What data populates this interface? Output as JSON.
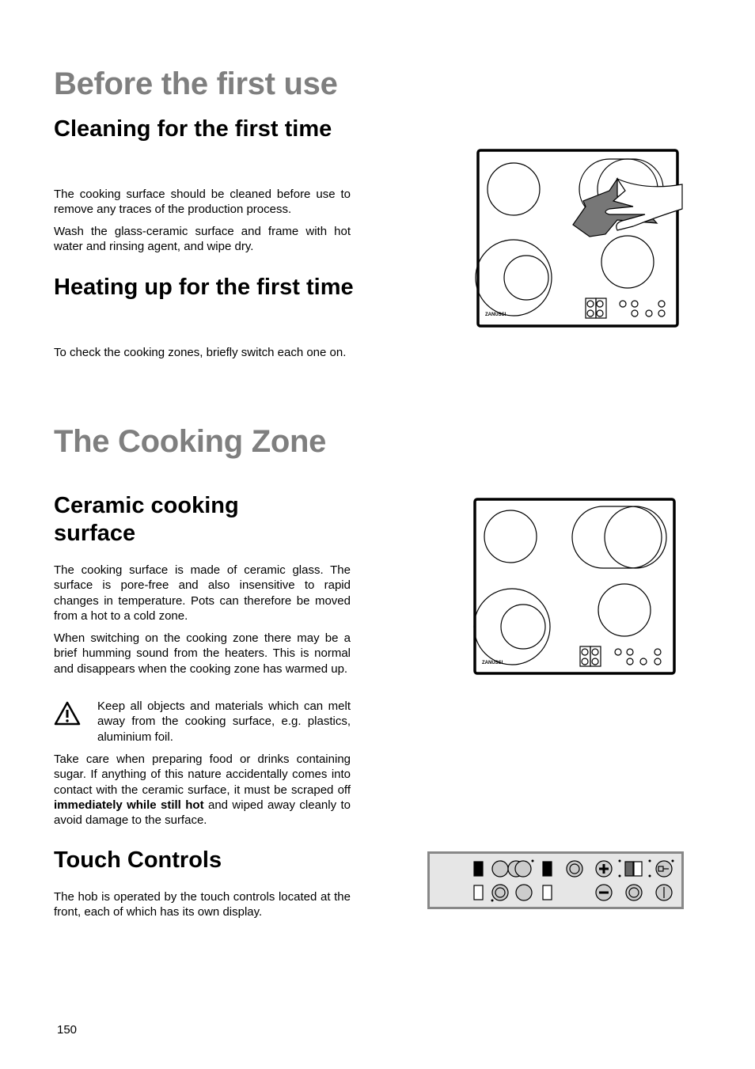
{
  "section1": {
    "title": "Before the first use",
    "cleaning": {
      "heading": "Cleaning for the first time",
      "p1": "The cooking surface should be cleaned before use to remove any traces of the production process.",
      "p2": "Wash the glass-ceramic surface and frame with hot water and rinsing agent, and wipe dry."
    },
    "heating": {
      "heading": "Heating up for the first time",
      "p1": "To check the cooking zones, briefly switch each one on."
    }
  },
  "section2": {
    "title": "The Cooking Zone",
    "ceramic": {
      "heading": "Ceramic cooking surface",
      "p1": "The cooking surface is made of ceramic glass. The surface is pore-free and also insensitive to rapid changes in temperature. Pots can therefore be moved from a hot to a cold zone.",
      "p2": "When switching on the cooking zone there may be a brief humming sound from the heaters. This is normal and disappears when the cooking zone has warmed up.",
      "warning": "Keep all objects and materials which can melt away from the cooking surface, e.g. plastics, aluminium foil.",
      "p3_before": "Take care when preparing food or drinks containing sugar. If anything of this nature accidentally comes into contact with the ceramic surface, it must be scraped off ",
      "p3_bold": "immediately while still hot",
      "p3_after": " and wiped away cleanly to avoid damage to the surface."
    },
    "touch": {
      "heading": "Touch Controls",
      "p1": "The hob is operated by the touch controls located at the front, each of which has its own display."
    }
  },
  "figures": {
    "brand_logo": "ZANUSSI",
    "icons": [
      "warning-triangle-icon",
      "plus-icon",
      "minus-icon",
      "timer-icon",
      "key-lock-icon",
      "power-icon"
    ]
  },
  "page_number": "150"
}
